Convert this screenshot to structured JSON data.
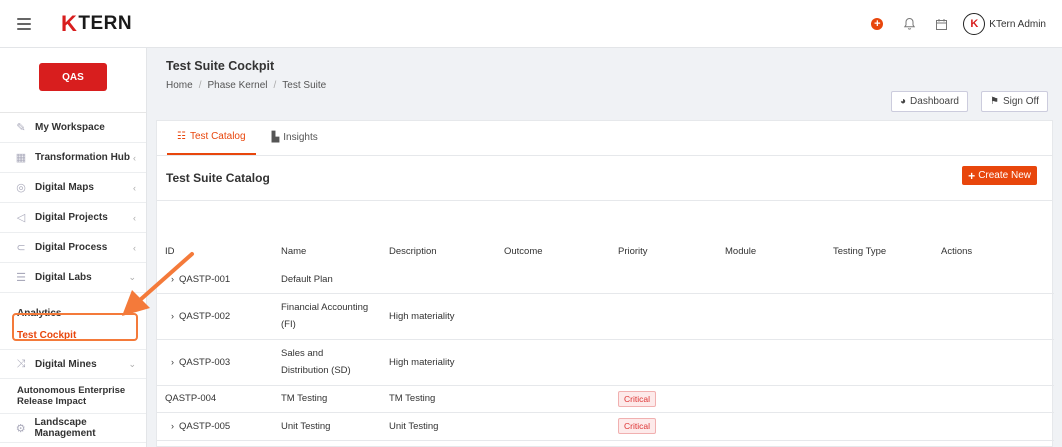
{
  "topbar": {
    "brand": "KTERN",
    "brand_k": "K",
    "user_name": "KTern Admin"
  },
  "sidebar": {
    "env": "QAS",
    "items": [
      {
        "label": "My Workspace",
        "icon": "edit-icon"
      },
      {
        "label": "Transformation Hub",
        "icon": "grid-icon"
      },
      {
        "label": "Digital Maps",
        "icon": "map-icon"
      },
      {
        "label": "Digital Projects",
        "icon": "send-icon"
      },
      {
        "label": "Digital Process",
        "icon": "process-icon"
      },
      {
        "label": "Digital Labs",
        "icon": "list-icon"
      }
    ],
    "subs": {
      "analytics": "Analytics",
      "test_cockpit": "Test Cockpit"
    },
    "mines": "Digital Mines",
    "autonomous": "Autonomous Enterprise Release Impact",
    "landscape": "Landscape Management"
  },
  "page": {
    "title": "Test Suite Cockpit",
    "breadcrumbs": [
      "Home",
      "Phase Kernel",
      "Test Suite"
    ],
    "dashboard_btn": "Dashboard",
    "signoff_btn": "Sign Off"
  },
  "tabs": {
    "catalog": "Test Catalog",
    "insights": "Insights"
  },
  "catalog": {
    "title": "Test Suite Catalog",
    "create": "Create New",
    "columns": [
      "ID",
      "Name",
      "Description",
      "Outcome",
      "Priority",
      "Module",
      "Testing Type",
      "Actions"
    ],
    "rows": [
      {
        "id": "QASTP-001",
        "name": "Default Plan",
        "desc": "",
        "priority": ""
      },
      {
        "id": "QASTP-002",
        "name": "Financial Accounting (FI)",
        "desc": "High materiality",
        "priority": ""
      },
      {
        "id": "QASTP-003",
        "name": "Sales and Distribution (SD)",
        "desc": "High materiality",
        "priority": ""
      },
      {
        "id": "QASTP-004",
        "name": "TM Testing",
        "desc": "TM Testing",
        "priority": "Critical"
      },
      {
        "id": "QASTP-005",
        "name": "Unit Testing",
        "desc": "Unit Testing",
        "priority": "Critical"
      }
    ]
  },
  "colors": {
    "accent": "#e8460c",
    "brand_red": "#d81e1e",
    "highlight": "#f47a3a"
  }
}
